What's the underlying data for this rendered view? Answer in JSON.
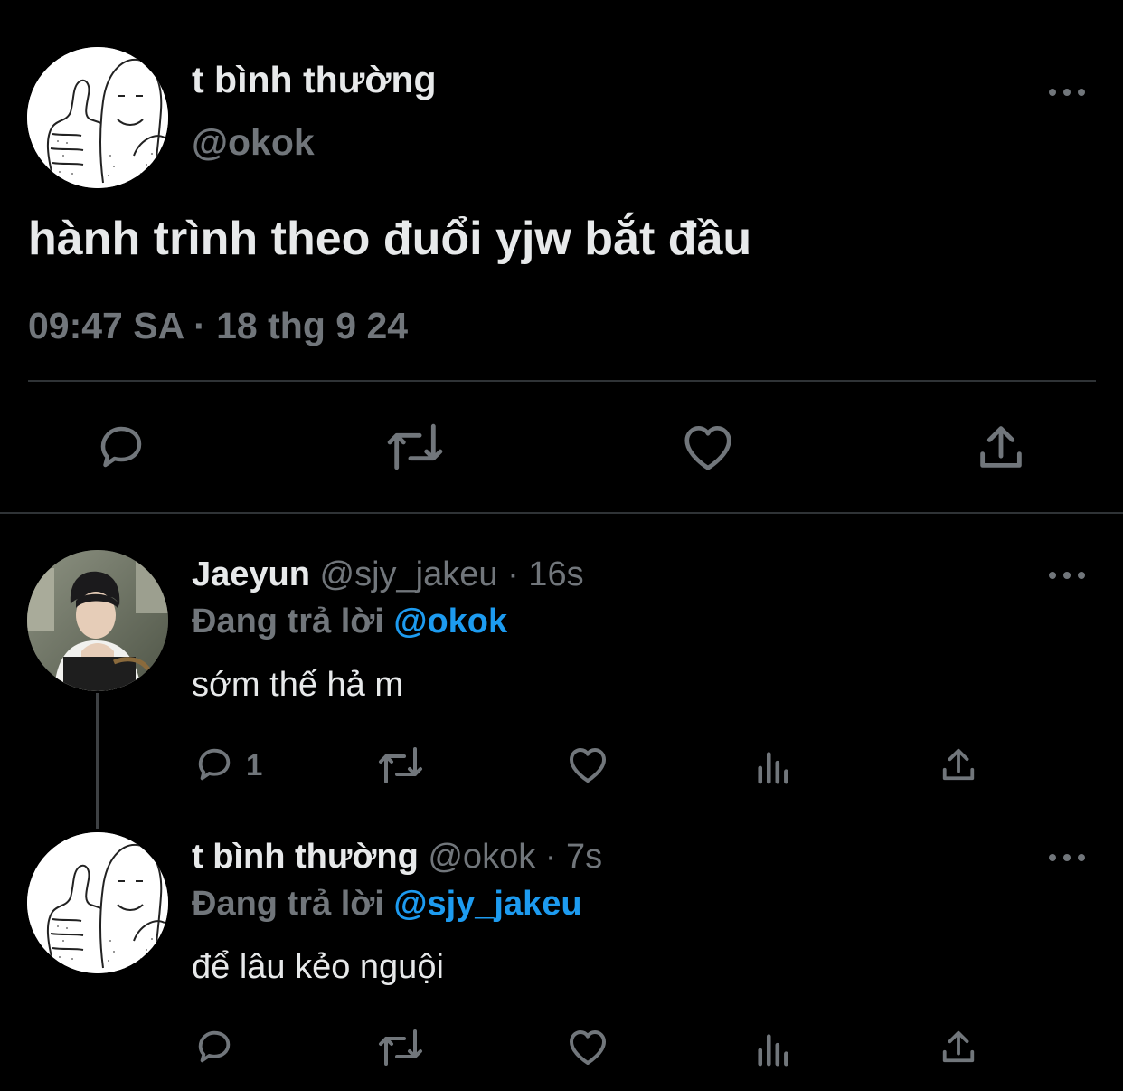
{
  "main_tweet": {
    "display_name": "t bình thường",
    "handle": "@okok",
    "text": "hành trình theo đuổi yjw bắt đầu",
    "timestamp": "09:47 SA · 18 thg 9 24",
    "avatar_icon": "meme-thumbs-up-drawing",
    "more_icon": "more-horizontal-icon",
    "actions": [
      "reply-icon",
      "retweet-icon",
      "like-icon",
      "share-icon"
    ]
  },
  "replies": [
    {
      "display_name": "Jaeyun",
      "handle": "@sjy_jakeu",
      "time": "· 16s",
      "replying_label": "Đang trả lời",
      "replying_to": "@okok",
      "text": "sớm thế hả m",
      "reply_count": "1",
      "avatar_icon": "user-photo-avatar",
      "actions": [
        "reply-icon",
        "retweet-icon",
        "like-icon",
        "analytics-icon",
        "share-icon"
      ]
    },
    {
      "display_name": "t bình thường",
      "handle": "@okok",
      "time": "· 7s",
      "replying_label": "Đang trả lời",
      "replying_to": "@sjy_jakeu",
      "text": "để lâu kẻo nguội",
      "reply_count": "",
      "avatar_icon": "meme-thumbs-up-drawing",
      "actions": [
        "reply-icon",
        "retweet-icon",
        "like-icon",
        "analytics-icon",
        "share-icon"
      ]
    }
  ],
  "colors": {
    "background": "#000000",
    "primary_text": "#e7e9ea",
    "secondary_text": "#71767b",
    "accent": "#1d9bf0",
    "divider": "#2f3336"
  }
}
